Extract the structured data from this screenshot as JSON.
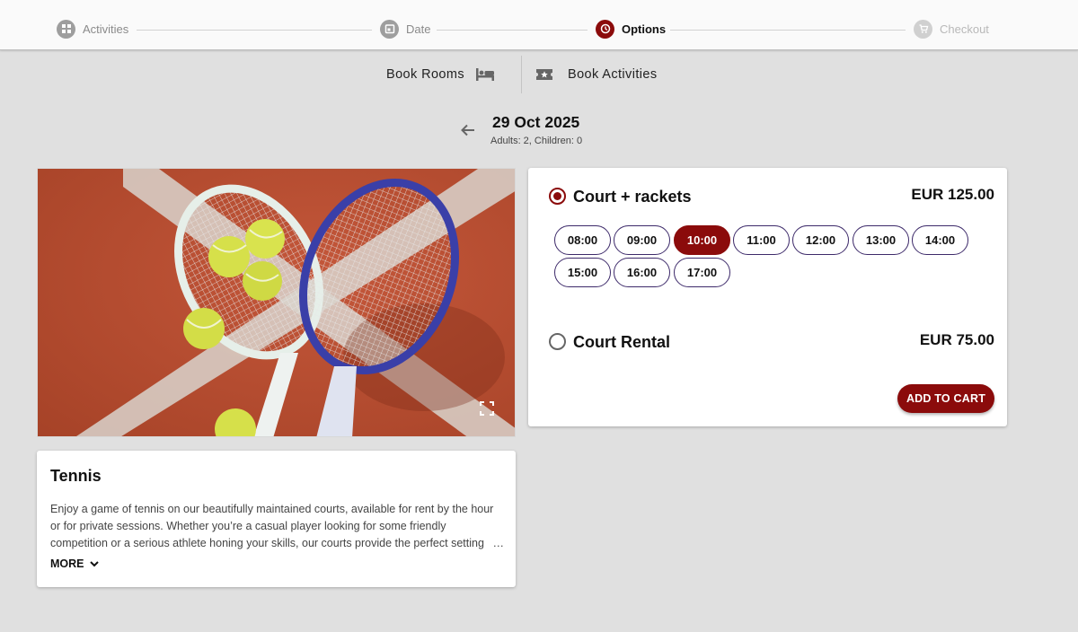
{
  "stepper": {
    "steps": [
      {
        "label": "Activities",
        "icon": "grid-icon",
        "state": "done"
      },
      {
        "label": "Date",
        "icon": "calendar-icon",
        "state": "done"
      },
      {
        "label": "Options",
        "icon": "clock-icon",
        "state": "active"
      },
      {
        "label": "Checkout",
        "icon": "cart-icon",
        "state": "disabled"
      }
    ]
  },
  "modes": {
    "rooms_label": "Book Rooms",
    "rooms_icon": "bed-icon",
    "activities_label": "Book Activities",
    "activities_icon": "ticket-icon"
  },
  "header": {
    "date": "29 Oct 2025",
    "guests": "Adults: 2, Children: 0"
  },
  "activity": {
    "image_alt": "Tennis rackets and balls on a clay court",
    "title": "Tennis",
    "description": "Enjoy a game of tennis on our beautifully maintained courts, available for rent by the hour or for private sessions. Whether you’re a casual player looking for some friendly competition or a serious athlete honing your skills, our courts provide the perfect setting",
    "ellipsis": "…",
    "more_label": "MORE"
  },
  "options": [
    {
      "name": "Court + rackets",
      "price": "EUR 125.00",
      "selected": true,
      "slots": [
        "08:00",
        "09:00",
        "10:00",
        "11:00",
        "12:00",
        "13:00",
        "14:00",
        "15:00",
        "16:00",
        "17:00"
      ],
      "selected_slot": "10:00"
    },
    {
      "name": "Court Rental",
      "price": "EUR 75.00",
      "selected": false
    }
  ],
  "cart": {
    "add_label": "ADD TO CART"
  },
  "colors": {
    "accent": "#8b0b0b",
    "slot_border": "#3d2a6a",
    "background": "#e0e0e0"
  }
}
